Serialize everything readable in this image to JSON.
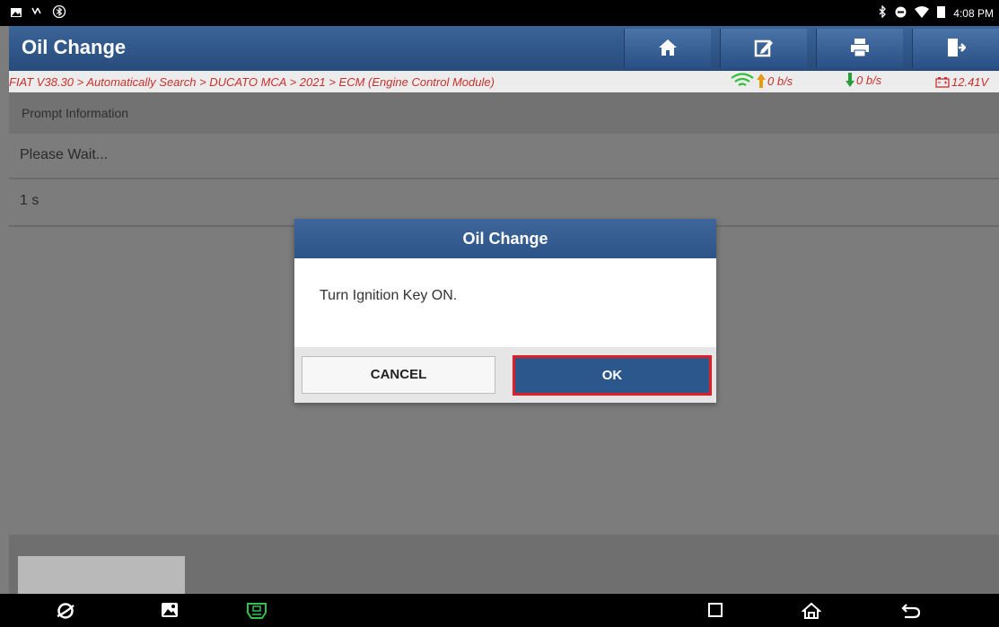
{
  "status_bar": {
    "time": "4:08 PM",
    "left_icons": [
      "image-icon",
      "usb-icon",
      "bluetooth-search-icon"
    ],
    "right_icons": [
      "bluetooth-icon",
      "do-not-disturb-icon",
      "wifi-icon",
      "battery-icon"
    ]
  },
  "title_bar": {
    "title": "Oil Change",
    "buttons": [
      "home-icon",
      "edit-icon",
      "print-icon",
      "exit-icon"
    ]
  },
  "breadcrumb": {
    "text": "FIAT V38.30 > Automatically Search > DUCATO MCA > 2021 > ECM (Engine Control Module)",
    "upload": "0 b/s",
    "download": "0 b/s",
    "voltage": "12.41V"
  },
  "content": {
    "header": "Prompt Information",
    "message": "Please Wait...",
    "timer": "1 s"
  },
  "dialog": {
    "title": "Oil Change",
    "message": "Turn Ignition Key ON.",
    "cancel_label": "CANCEL",
    "ok_label": "OK"
  },
  "nav_bar": {
    "icons": [
      "browser-icon",
      "gallery-icon",
      "vci-icon",
      "recents-icon",
      "home-nav-icon",
      "back-icon"
    ]
  },
  "colors": {
    "title_blue": "#2c5388",
    "breadcrumb_red": "#c9302c",
    "ok_highlight_red": "#e11d2a"
  }
}
